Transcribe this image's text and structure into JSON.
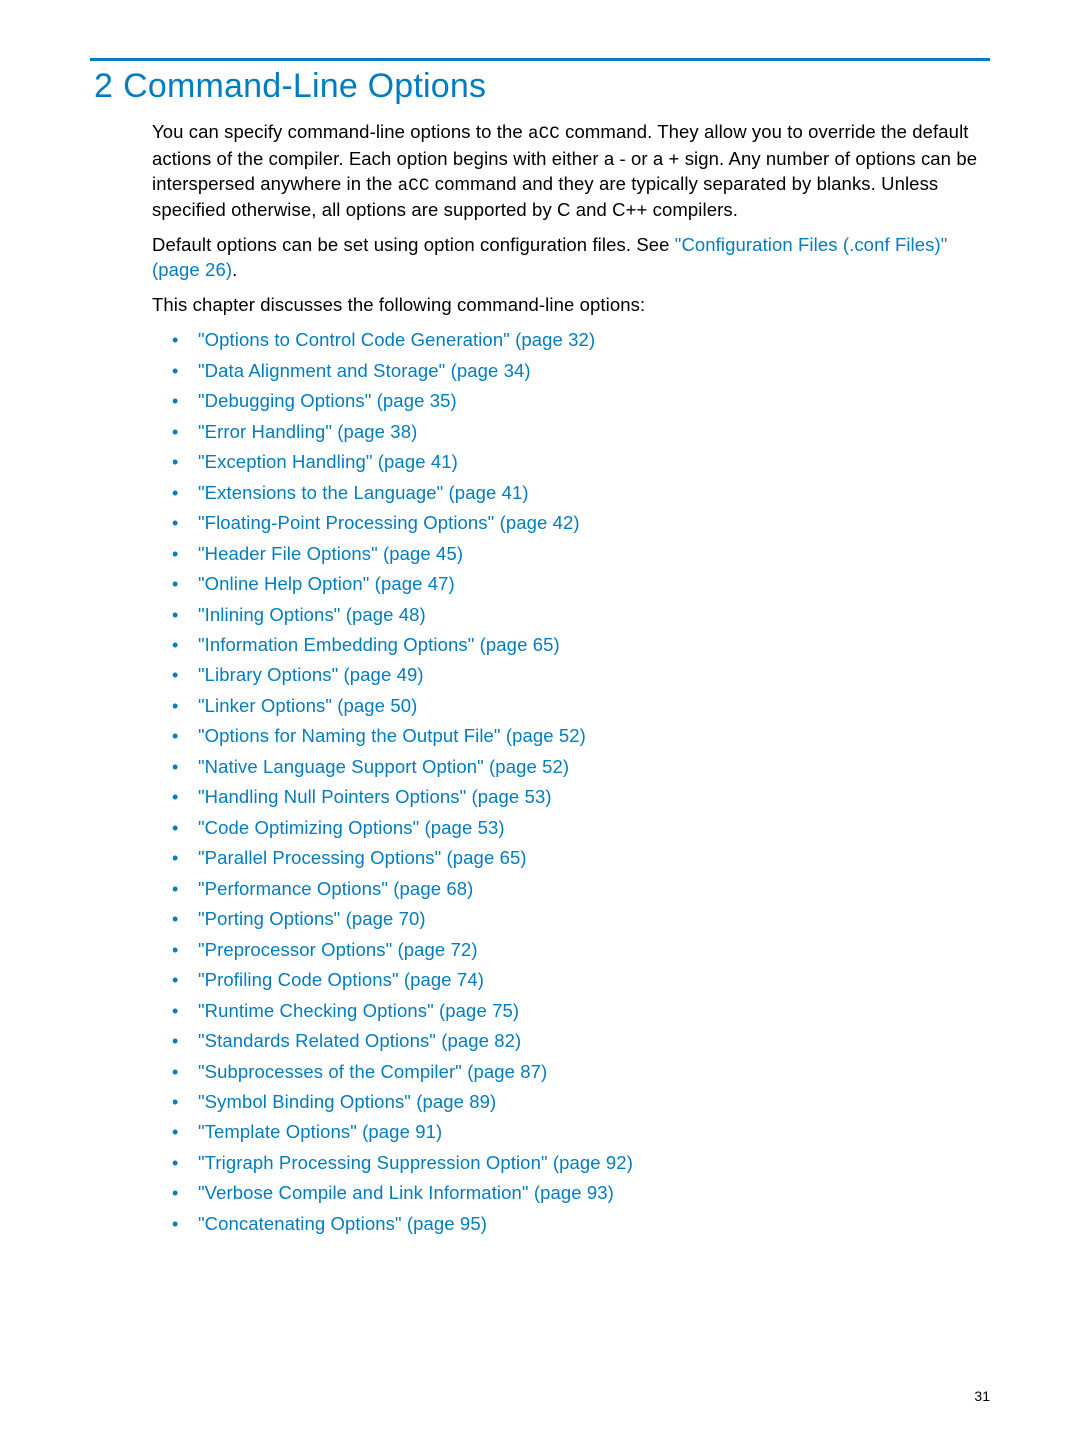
{
  "chapter": {
    "number": "2",
    "title": "Command-Line Options"
  },
  "paragraphs": {
    "p1a": "You can specify command-line options to the ",
    "p1_code1": "aCC",
    "p1b": " command. They allow you to override the default actions of the compiler. Each option begins with either a - or a + sign. Any number of options can be interspersed anywhere in the ",
    "p1_code2": "aCC",
    "p1c": " command and they are typically separated by blanks. Unless specified otherwise, all options are supported by C and C++ compilers.",
    "p2a": "Default options can be set using option configuration files. See ",
    "p2_link": "\"Configuration Files (.conf Files)\" (page 26)",
    "p2b": ".",
    "p3": "This chapter discusses the following command-line options:"
  },
  "toc": [
    "\"Options to Control Code Generation\" (page 32)",
    "\"Data Alignment and Storage\" (page 34)",
    "\"Debugging Options\" (page 35)",
    "\"Error Handling\" (page 38)",
    "\"Exception Handling\" (page 41)",
    "\"Extensions to the Language\" (page 41)",
    "\"Floating-Point Processing Options\" (page 42)",
    "\"Header File Options\" (page 45)",
    "\"Online Help Option\" (page 47)",
    "\"Inlining Options\" (page 48)",
    "\"Information Embedding Options\" (page 65)",
    "\"Library Options\" (page 49)",
    "\"Linker Options\" (page 50)",
    "\"Options for Naming the Output File\" (page 52)",
    "\"Native Language Support Option\" (page 52)",
    "\"Handling Null Pointers Options\" (page 53)",
    "\"Code Optimizing Options\" (page 53)",
    "\"Parallel Processing Options\" (page 65)",
    "\"Performance Options\" (page 68)",
    "\"Porting Options\" (page 70)",
    "\"Preprocessor Options\" (page 72)",
    "\"Profiling Code Options\" (page 74)",
    "\"Runtime Checking Options\" (page 75)",
    "\"Standards Related Options\" (page 82)",
    "\"Subprocesses of the Compiler\" (page 87)",
    "\"Symbol Binding Options\" (page 89)",
    "\"Template Options\" (page 91)",
    "\"Trigraph Processing Suppression Option\" (page 92)",
    "\"Verbose Compile and Link Information\" (page 93)",
    "\"Concatenating Options\" (page 95)"
  ],
  "page_number": "31"
}
